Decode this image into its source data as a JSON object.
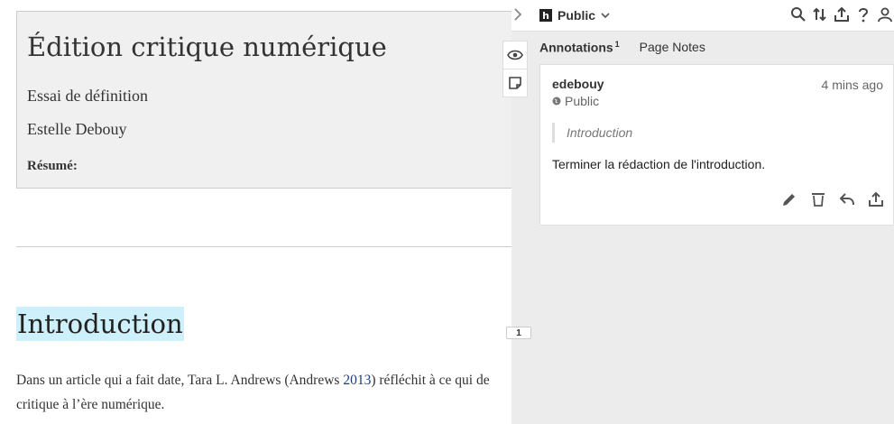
{
  "document": {
    "title": "Édition critique numérique",
    "subtitle": "Essai de définition",
    "author": "Estelle Debouy",
    "abstract_label": "Résumé:",
    "section_heading": "Introduction",
    "paragraph": {
      "line1_start": "Dans un article qui a fait date, Tara L. Andrews (Andrews ",
      "citation_year": "2013",
      "line1_end": ") réfléchit à ce qui de",
      "line2": "critique à l’ère numérique."
    }
  },
  "sidebar": {
    "group_label": "Public",
    "tabs": [
      {
        "label": "Annotations",
        "count": "1"
      },
      {
        "label": "Page Notes"
      }
    ],
    "icons": [
      "search-icon",
      "sort-icon",
      "share-icon",
      "help-icon",
      "user-icon"
    ],
    "bucket_count": "1",
    "annotation": {
      "user": "edebouy",
      "time": "4 mins ago",
      "visibility": "Public",
      "quote": "Introduction",
      "text": "Terminer la rédaction de l'introduction."
    }
  },
  "colors": {
    "highlight": "#cdf0fa",
    "sidebar_bg": "#ececec",
    "title_box_bg": "#f0f0f0"
  }
}
